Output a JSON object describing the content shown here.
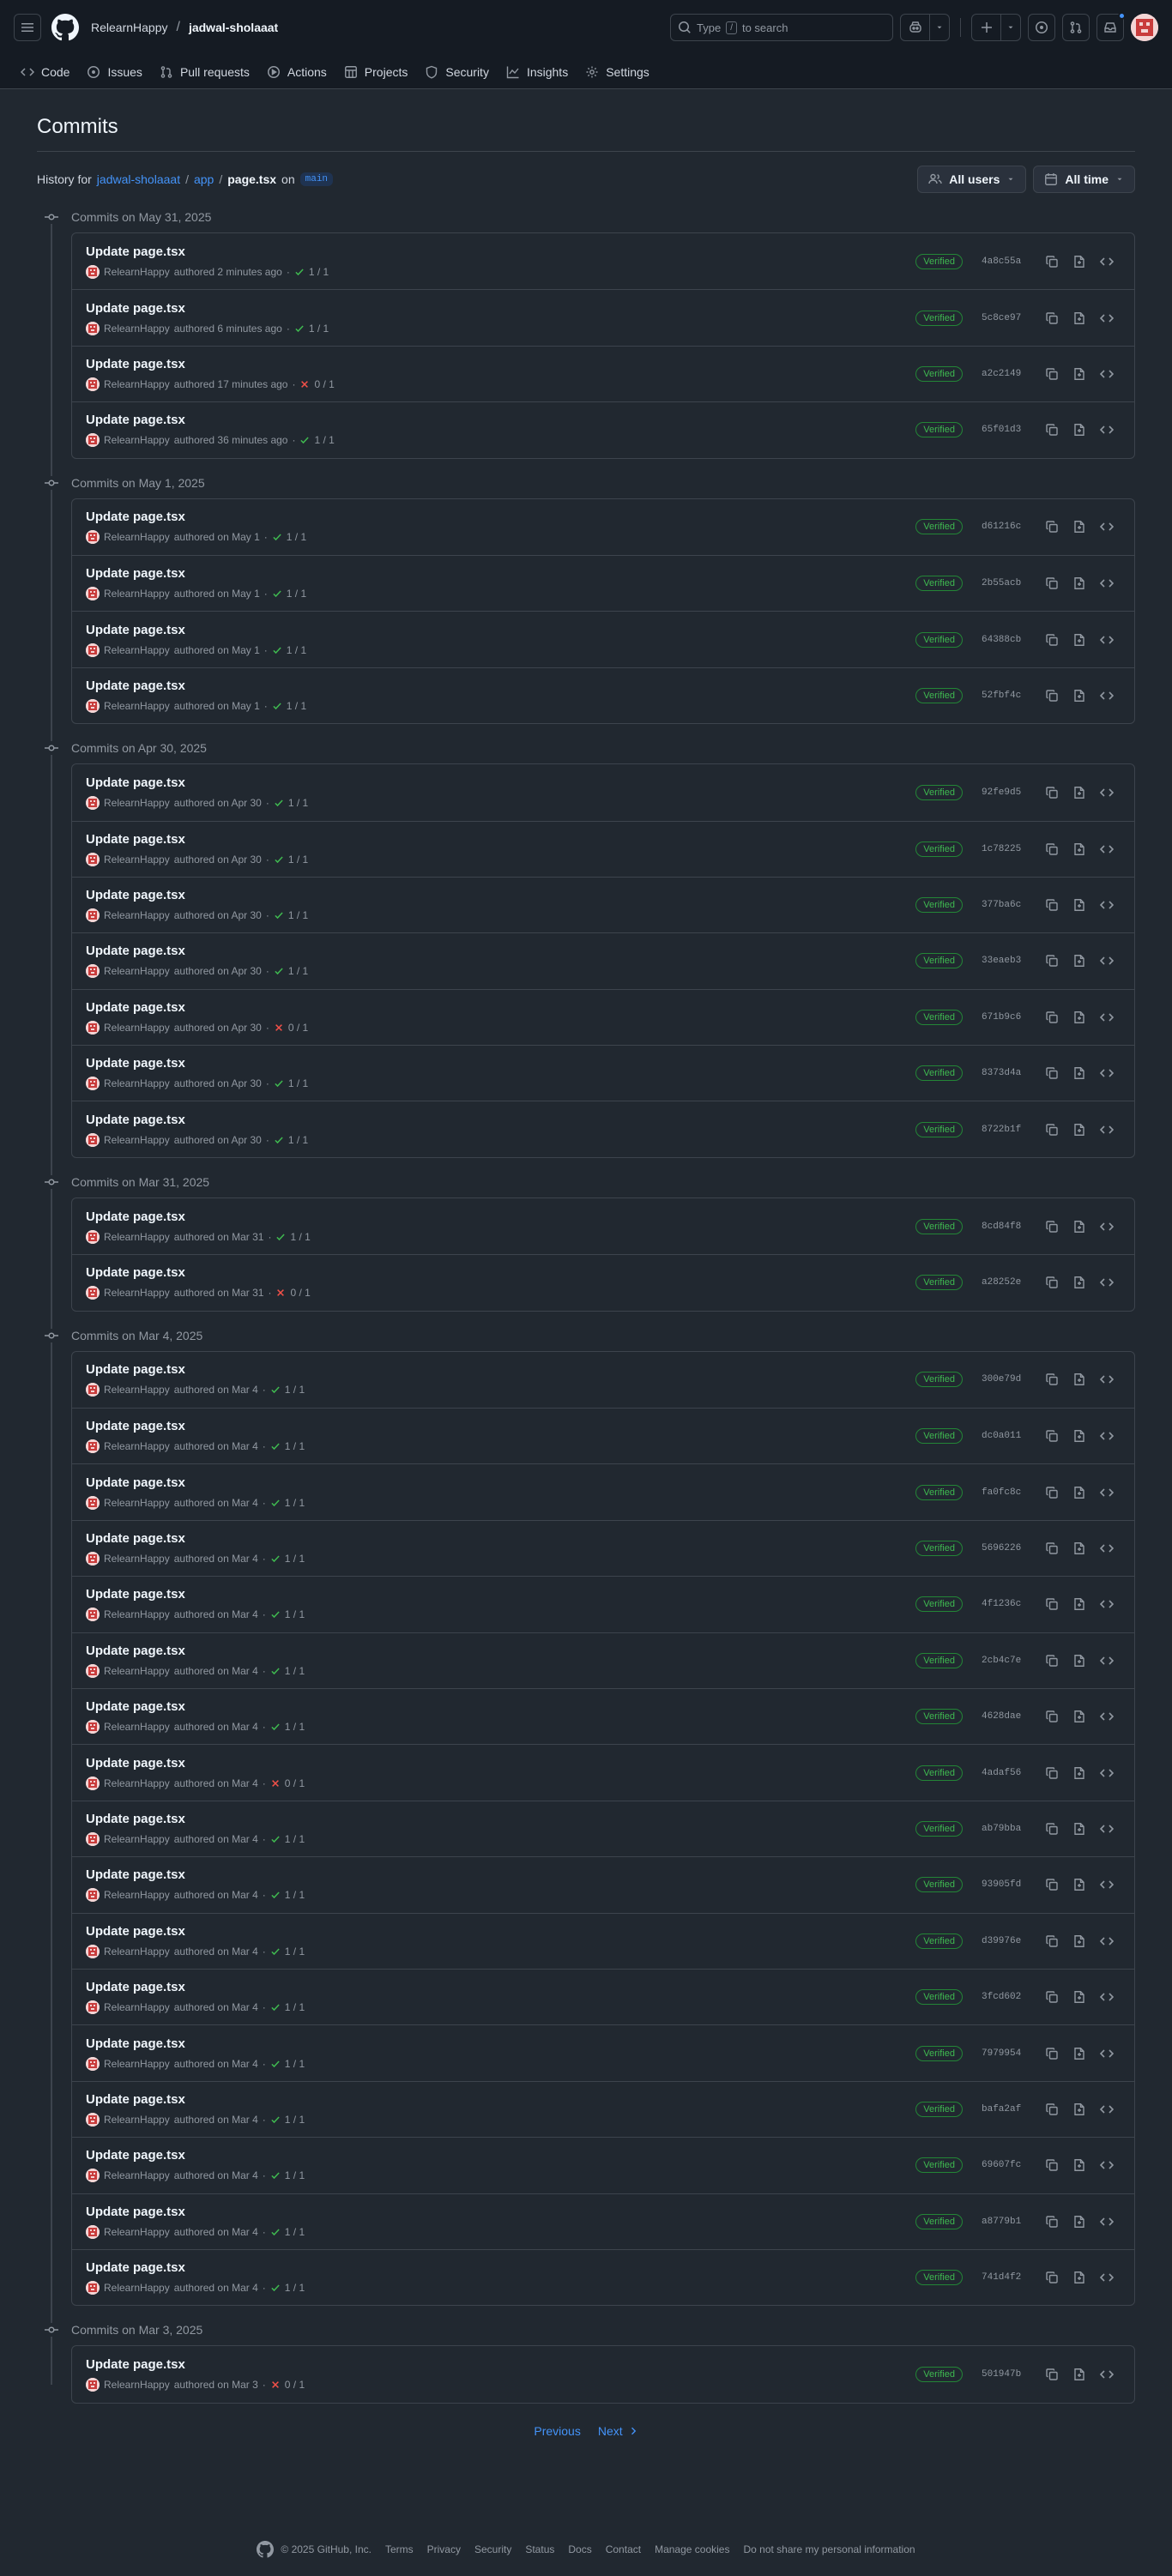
{
  "header": {
    "owner": "RelearnHappy",
    "separator": "/",
    "repo": "jadwal-sholaaat",
    "search_pre": "Type",
    "search_key": "/",
    "search_post": "to search"
  },
  "nav": {
    "tabs": [
      {
        "label": "Code",
        "icon": "code-icon"
      },
      {
        "label": "Issues",
        "icon": "issue-icon"
      },
      {
        "label": "Pull requests",
        "icon": "pull-request-icon"
      },
      {
        "label": "Actions",
        "icon": "play-icon"
      },
      {
        "label": "Projects",
        "icon": "table-icon"
      },
      {
        "label": "Security",
        "icon": "shield-icon"
      },
      {
        "label": "Insights",
        "icon": "graph-icon"
      },
      {
        "label": "Settings",
        "icon": "gear-icon"
      }
    ]
  },
  "page": {
    "title": "Commits",
    "history_label": "History for",
    "history_repo": "jadwal-sholaaat",
    "history_dir": "app",
    "history_file": "page.tsx",
    "history_on": "on",
    "branch": "main",
    "filter_users": "All users",
    "filter_time": "All time"
  },
  "commit_groups": [
    {
      "date": "Commits on May 31, 2025",
      "commits": [
        {
          "title": "Update page.tsx",
          "author": "RelearnHappy",
          "when": "authored 2 minutes ago",
          "status": "ok",
          "checks": "1 / 1",
          "badge": "Verified",
          "sha": "4a8c55a"
        },
        {
          "title": "Update page.tsx",
          "author": "RelearnHappy",
          "when": "authored 6 minutes ago",
          "status": "ok",
          "checks": "1 / 1",
          "badge": "Verified",
          "sha": "5c8ce97"
        },
        {
          "title": "Update page.tsx",
          "author": "RelearnHappy",
          "when": "authored 17 minutes ago",
          "status": "fail",
          "checks": "0 / 1",
          "badge": "Verified",
          "sha": "a2c2149"
        },
        {
          "title": "Update page.tsx",
          "author": "RelearnHappy",
          "when": "authored 36 minutes ago",
          "status": "ok",
          "checks": "1 / 1",
          "badge": "Verified",
          "sha": "65f01d3"
        }
      ]
    },
    {
      "date": "Commits on May 1, 2025",
      "commits": [
        {
          "title": "Update page.tsx",
          "author": "RelearnHappy",
          "when": "authored on May 1",
          "status": "ok",
          "checks": "1 / 1",
          "badge": "Verified",
          "sha": "d61216c"
        },
        {
          "title": "Update page.tsx",
          "author": "RelearnHappy",
          "when": "authored on May 1",
          "status": "ok",
          "checks": "1 / 1",
          "badge": "Verified",
          "sha": "2b55acb"
        },
        {
          "title": "Update page.tsx",
          "author": "RelearnHappy",
          "when": "authored on May 1",
          "status": "ok",
          "checks": "1 / 1",
          "badge": "Verified",
          "sha": "64388cb"
        },
        {
          "title": "Update page.tsx",
          "author": "RelearnHappy",
          "when": "authored on May 1",
          "status": "ok",
          "checks": "1 / 1",
          "badge": "Verified",
          "sha": "52fbf4c"
        }
      ]
    },
    {
      "date": "Commits on Apr 30, 2025",
      "commits": [
        {
          "title": "Update page.tsx",
          "author": "RelearnHappy",
          "when": "authored on Apr 30",
          "status": "ok",
          "checks": "1 / 1",
          "badge": "Verified",
          "sha": "92fe9d5"
        },
        {
          "title": "Update page.tsx",
          "author": "RelearnHappy",
          "when": "authored on Apr 30",
          "status": "ok",
          "checks": "1 / 1",
          "badge": "Verified",
          "sha": "1c78225"
        },
        {
          "title": "Update page.tsx",
          "author": "RelearnHappy",
          "when": "authored on Apr 30",
          "status": "ok",
          "checks": "1 / 1",
          "badge": "Verified",
          "sha": "377ba6c"
        },
        {
          "title": "Update page.tsx",
          "author": "RelearnHappy",
          "when": "authored on Apr 30",
          "status": "ok",
          "checks": "1 / 1",
          "badge": "Verified",
          "sha": "33eaeb3"
        },
        {
          "title": "Update page.tsx",
          "author": "RelearnHappy",
          "when": "authored on Apr 30",
          "status": "fail",
          "checks": "0 / 1",
          "badge": "Verified",
          "sha": "671b9c6"
        },
        {
          "title": "Update page.tsx",
          "author": "RelearnHappy",
          "when": "authored on Apr 30",
          "status": "ok",
          "checks": "1 / 1",
          "badge": "Verified",
          "sha": "8373d4a"
        },
        {
          "title": "Update page.tsx",
          "author": "RelearnHappy",
          "when": "authored on Apr 30",
          "status": "ok",
          "checks": "1 / 1",
          "badge": "Verified",
          "sha": "8722b1f"
        }
      ]
    },
    {
      "date": "Commits on Mar 31, 2025",
      "commits": [
        {
          "title": "Update page.tsx",
          "author": "RelearnHappy",
          "when": "authored on Mar 31",
          "status": "ok",
          "checks": "1 / 1",
          "badge": "Verified",
          "sha": "8cd84f8"
        },
        {
          "title": "Update page.tsx",
          "author": "RelearnHappy",
          "when": "authored on Mar 31",
          "status": "fail",
          "checks": "0 / 1",
          "badge": "Verified",
          "sha": "a28252e"
        }
      ]
    },
    {
      "date": "Commits on Mar 4, 2025",
      "commits": [
        {
          "title": "Update page.tsx",
          "author": "RelearnHappy",
          "when": "authored on Mar 4",
          "status": "ok",
          "checks": "1 / 1",
          "badge": "Verified",
          "sha": "300e79d"
        },
        {
          "title": "Update page.tsx",
          "author": "RelearnHappy",
          "when": "authored on Mar 4",
          "status": "ok",
          "checks": "1 / 1",
          "badge": "Verified",
          "sha": "dc0a011"
        },
        {
          "title": "Update page.tsx",
          "author": "RelearnHappy",
          "when": "authored on Mar 4",
          "status": "ok",
          "checks": "1 / 1",
          "badge": "Verified",
          "sha": "fa0fc8c"
        },
        {
          "title": "Update page.tsx",
          "author": "RelearnHappy",
          "when": "authored on Mar 4",
          "status": "ok",
          "checks": "1 / 1",
          "badge": "Verified",
          "sha": "5696226"
        },
        {
          "title": "Update page.tsx",
          "author": "RelearnHappy",
          "when": "authored on Mar 4",
          "status": "ok",
          "checks": "1 / 1",
          "badge": "Verified",
          "sha": "4f1236c"
        },
        {
          "title": "Update page.tsx",
          "author": "RelearnHappy",
          "when": "authored on Mar 4",
          "status": "ok",
          "checks": "1 / 1",
          "badge": "Verified",
          "sha": "2cb4c7e"
        },
        {
          "title": "Update page.tsx",
          "author": "RelearnHappy",
          "when": "authored on Mar 4",
          "status": "ok",
          "checks": "1 / 1",
          "badge": "Verified",
          "sha": "4628dae"
        },
        {
          "title": "Update page.tsx",
          "author": "RelearnHappy",
          "when": "authored on Mar 4",
          "status": "fail",
          "checks": "0 / 1",
          "badge": "Verified",
          "sha": "4adaf56"
        },
        {
          "title": "Update page.tsx",
          "author": "RelearnHappy",
          "when": "authored on Mar 4",
          "status": "ok",
          "checks": "1 / 1",
          "badge": "Verified",
          "sha": "ab79bba"
        },
        {
          "title": "Update page.tsx",
          "author": "RelearnHappy",
          "when": "authored on Mar 4",
          "status": "ok",
          "checks": "1 / 1",
          "badge": "Verified",
          "sha": "93905fd"
        },
        {
          "title": "Update page.tsx",
          "author": "RelearnHappy",
          "when": "authored on Mar 4",
          "status": "ok",
          "checks": "1 / 1",
          "badge": "Verified",
          "sha": "d39976e"
        },
        {
          "title": "Update page.tsx",
          "author": "RelearnHappy",
          "when": "authored on Mar 4",
          "status": "ok",
          "checks": "1 / 1",
          "badge": "Verified",
          "sha": "3fcd602"
        },
        {
          "title": "Update page.tsx",
          "author": "RelearnHappy",
          "when": "authored on Mar 4",
          "status": "ok",
          "checks": "1 / 1",
          "badge": "Verified",
          "sha": "7979954"
        },
        {
          "title": "Update page.tsx",
          "author": "RelearnHappy",
          "when": "authored on Mar 4",
          "status": "ok",
          "checks": "1 / 1",
          "badge": "Verified",
          "sha": "bafa2af"
        },
        {
          "title": "Update page.tsx",
          "author": "RelearnHappy",
          "when": "authored on Mar 4",
          "status": "ok",
          "checks": "1 / 1",
          "badge": "Verified",
          "sha": "69607fc"
        },
        {
          "title": "Update page.tsx",
          "author": "RelearnHappy",
          "when": "authored on Mar 4",
          "status": "ok",
          "checks": "1 / 1",
          "badge": "Verified",
          "sha": "a8779b1"
        },
        {
          "title": "Update page.tsx",
          "author": "RelearnHappy",
          "when": "authored on Mar 4",
          "status": "ok",
          "checks": "1 / 1",
          "badge": "Verified",
          "sha": "741d4f2"
        }
      ]
    },
    {
      "date": "Commits on Mar 3, 2025",
      "commits": [
        {
          "title": "Update page.tsx",
          "author": "RelearnHappy",
          "when": "authored on Mar 3",
          "status": "fail",
          "checks": "0 / 1",
          "badge": "Verified",
          "sha": "501947b"
        }
      ]
    }
  ],
  "pagination": {
    "previous": "Previous",
    "next": "Next"
  },
  "footer": {
    "copyright": "© 2025 GitHub, Inc.",
    "links": [
      "Terms",
      "Privacy",
      "Security",
      "Status",
      "Docs",
      "Contact",
      "Manage cookies",
      "Do not share my personal information"
    ]
  },
  "colors": {
    "background": "#212830",
    "header_bg": "#151b23",
    "border": "#3d444d",
    "link": "#4493f8",
    "success": "#3fb950",
    "danger": "#f85149"
  }
}
